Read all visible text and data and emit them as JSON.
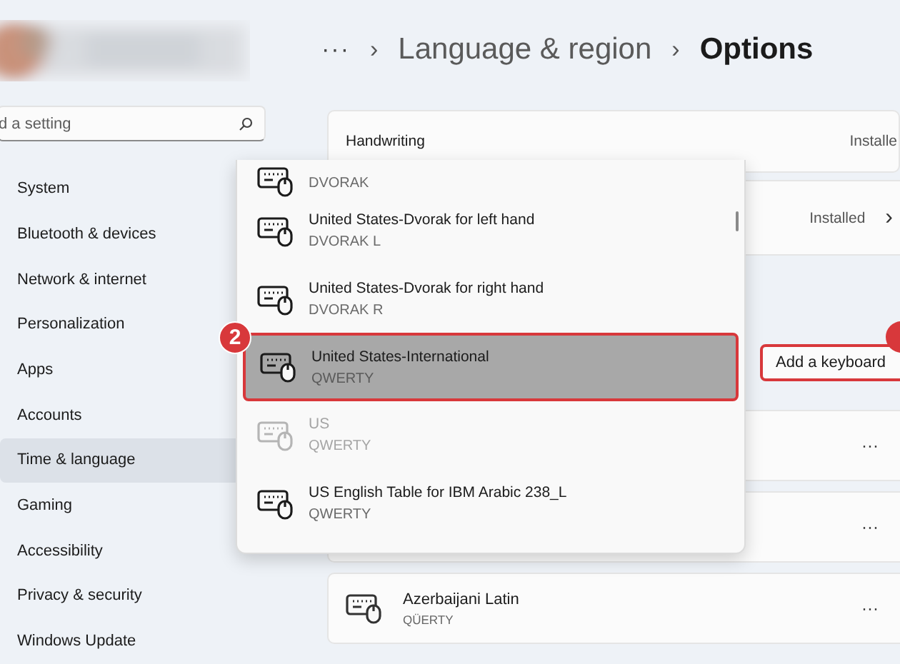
{
  "sidebar": {
    "search": {
      "placeholder": "d a setting"
    },
    "items": [
      {
        "label": "System",
        "selected": false
      },
      {
        "label": "Bluetooth & devices",
        "selected": false
      },
      {
        "label": "Network & internet",
        "selected": false
      },
      {
        "label": "Personalization",
        "selected": false
      },
      {
        "label": "Apps",
        "selected": false
      },
      {
        "label": "Accounts",
        "selected": false
      },
      {
        "label": "Time & language",
        "selected": true
      },
      {
        "label": "Gaming",
        "selected": false
      },
      {
        "label": "Accessibility",
        "selected": false
      },
      {
        "label": "Privacy & security",
        "selected": false
      },
      {
        "label": "Windows Update",
        "selected": false
      }
    ]
  },
  "breadcrumb": {
    "overflow": "···",
    "separator": "›",
    "items": [
      "Language & region",
      "Options"
    ]
  },
  "cards": [
    {
      "kind": "setting",
      "label": "Handwriting",
      "status": "Installe"
    },
    {
      "kind": "link",
      "status": "Installed",
      "chevron": "›"
    }
  ],
  "keyboards": {
    "add_button": {
      "label": "Add a keyboard",
      "highlighted": true,
      "badge": true
    },
    "rows": [
      {
        "more": "···"
      },
      {
        "more": "···"
      },
      {
        "name": "Azerbaijani Latin",
        "layout": "QÜERTY",
        "more": "···"
      }
    ]
  },
  "dropdown": {
    "items": [
      {
        "layout": "DVORAK",
        "selected": false,
        "disabled": false
      },
      {
        "name": "United States-Dvorak for left hand",
        "layout": "DVORAK L",
        "selected": false,
        "disabled": false
      },
      {
        "name": "United States-Dvorak for right hand",
        "layout": "DVORAK R",
        "selected": false,
        "disabled": false
      },
      {
        "name": "United States-International",
        "layout": "QWERTY",
        "selected": true,
        "disabled": false,
        "badge": "2"
      },
      {
        "name": "US",
        "layout": "QWERTY",
        "selected": false,
        "disabled": true
      },
      {
        "name": "US English Table for IBM Arabic 238_L",
        "layout": "QWERTY",
        "selected": false,
        "disabled": false
      }
    ]
  }
}
